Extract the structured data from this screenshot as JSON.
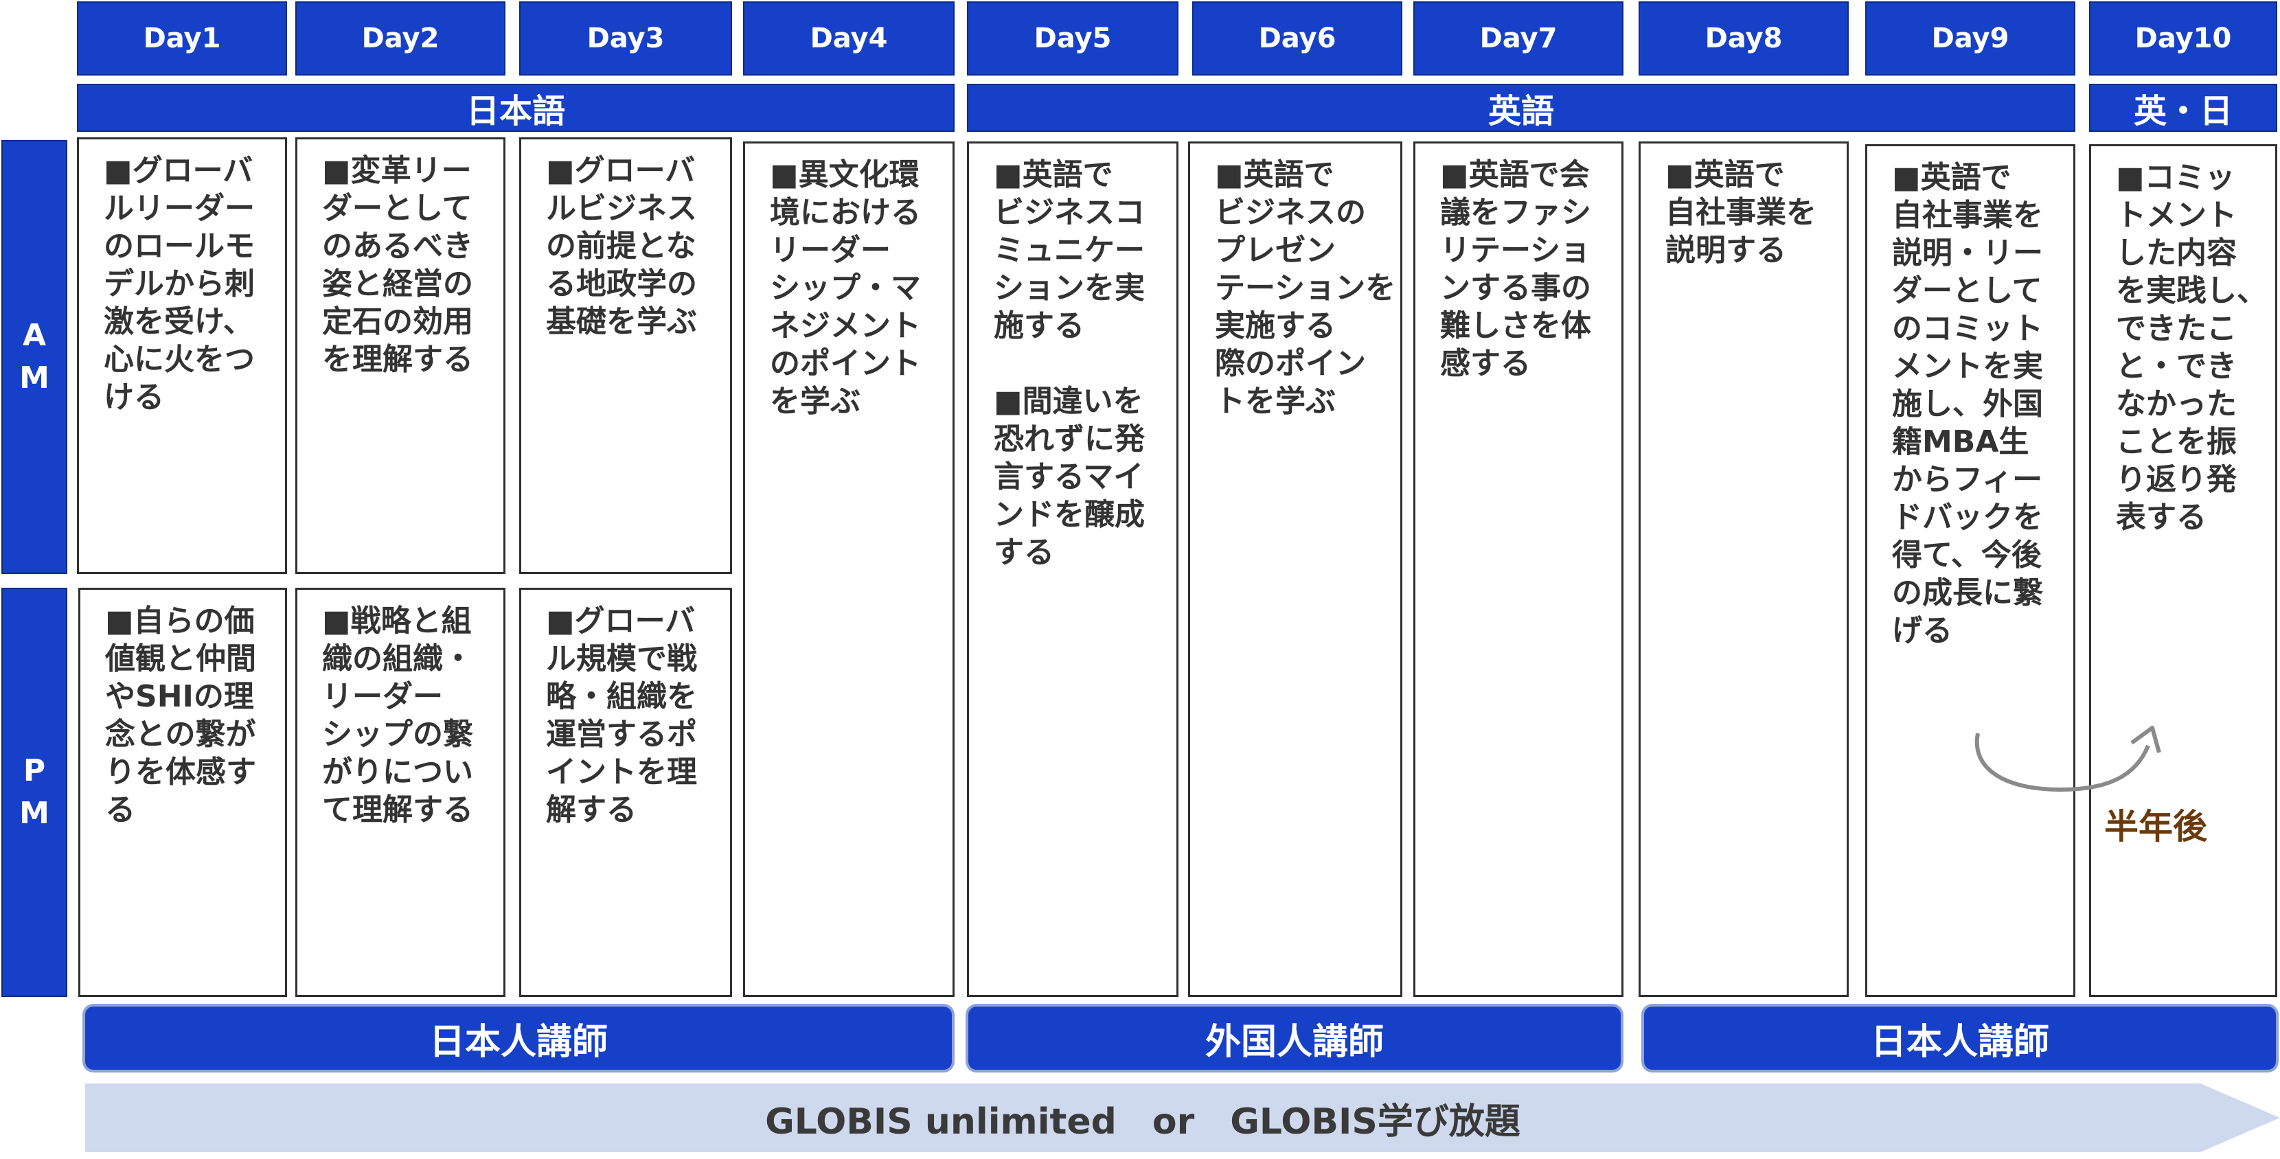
{
  "days": [
    "Day1",
    "Day2",
    "Day3",
    "Day4",
    "Day5",
    "Day6",
    "Day7",
    "Day8",
    "Day9",
    "Day10"
  ],
  "languages": [
    "日本語",
    "英語",
    "英・日"
  ],
  "sessions": {
    "am": "A\nM",
    "pm": "P\nM"
  },
  "cells": {
    "day1_am": "■グローバ\nルリーダー\nのロールモ\nデルから刺\n激を受け、\n心に火をつ\nける",
    "day1_pm": "■自らの価\n値観と仲間\nやSHIの理\n念との繋が\nりを体感す\nる",
    "day2_am": "■変革リー\nダーとして\nのあるべき\n姿と経営の\n定石の効用\nを理解する",
    "day2_pm": "■戦略と組\n織の組織・\nリーダー\nシップの繋\nがりについ\nて理解する",
    "day3_am": "■グローバ\nルビジネス\nの前提とな\nる地政学の\n基礎を学ぶ",
    "day3_pm": "■グローバ\nル規模で戦\n略・組織を\n運営するポ\nイントを理\n解する",
    "day4": "■異文化環\n境における\nリーダー\nシップ・マ\nネジメント\nのポイント\nを学ぶ",
    "day5": "■英語で\nビジネスコ\nミュニケー\nションを実\n施する\n\n■間違いを\n恐れずに発\n言するマイ\nンドを醸成\nする",
    "day6": "■英語で\nビジネスの\nプレゼン\nテーションを\n実施する\n際のポイン\nトを学ぶ",
    "day7": "■英語で会\n議をファシ\nリテーショ\nンする事の\n難しさを体\n感する",
    "day8": "■英語で\n自社事業を\n説明する",
    "day9": "■英語で\n自社事業を\n説明・リー\nダーとして\nのコミット\nメントを実\n施し、外国\n籍MBA生\nからフィー\nドバックを\n得て、今後\nの成長に繋\nげる",
    "day10": "■コミッ\nトメント\nした内容\nを実践し、\nできたこ\nと・でき\nなかった\nことを振\nり返り発\n表する"
  },
  "half_year_label": "半年後",
  "instructors": [
    "日本人講師",
    "外国人講師",
    "日本人講師"
  ],
  "platform": "GLOBIS unlimited　or　GLOBIS学び放題",
  "colors": {
    "header_blue": "#1740c8",
    "arrow_light": "#cfd9ee",
    "half_year_text": "#6b3a0a",
    "curve_arrow": "#8a8a8a"
  }
}
